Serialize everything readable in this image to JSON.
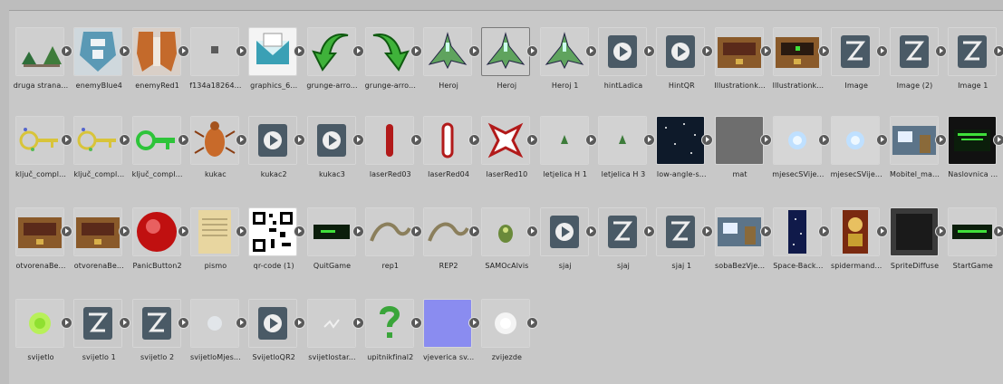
{
  "assets": [
    {
      "label": "druga strana...",
      "icon": "ship-pair"
    },
    {
      "label": "enemyBlue4",
      "icon": "enemy-blue"
    },
    {
      "label": "enemyRed1",
      "icon": "enemy-red"
    },
    {
      "label": "f134a18264...",
      "icon": "tiny-square"
    },
    {
      "label": "graphics_6...",
      "icon": "mail"
    },
    {
      "label": "grunge-arro...",
      "icon": "arrow-left"
    },
    {
      "label": "grunge-arro...",
      "icon": "arrow-right"
    },
    {
      "label": "Heroj",
      "icon": "ship"
    },
    {
      "label": "Heroj",
      "icon": "ship",
      "selected": true
    },
    {
      "label": "Heroj 1",
      "icon": "ship"
    },
    {
      "label": "hintLadica",
      "icon": "play"
    },
    {
      "label": "HintQR",
      "icon": "play"
    },
    {
      "label": "Illustrationk...",
      "icon": "chest"
    },
    {
      "label": "Illustrationk...",
      "icon": "chest-green"
    },
    {
      "label": "Image",
      "icon": "image-gen"
    },
    {
      "label": "Image (2)",
      "icon": "image-gen"
    },
    {
      "label": "Image 1",
      "icon": "image-gen"
    },
    {
      "label": "ključ_compl...",
      "icon": "key"
    },
    {
      "label": "ključ_compl...",
      "icon": "key"
    },
    {
      "label": "ključ_compl...",
      "icon": "key-green"
    },
    {
      "label": "kukac",
      "icon": "bug"
    },
    {
      "label": "kukac2",
      "icon": "play"
    },
    {
      "label": "kukac3",
      "icon": "play"
    },
    {
      "label": "laserRed03",
      "icon": "laser"
    },
    {
      "label": "laserRed04",
      "icon": "laser-outline"
    },
    {
      "label": "laserRed10",
      "icon": "laser-x"
    },
    {
      "label": "letjelica H 1",
      "icon": "tiny-ship"
    },
    {
      "label": "letjelica H 3",
      "icon": "tiny-ship"
    },
    {
      "label": "low-angle-s...",
      "icon": "night"
    },
    {
      "label": "mat",
      "icon": "gray"
    },
    {
      "label": "mjesecSVije...",
      "icon": "glow-blue"
    },
    {
      "label": "mjesecSVije...",
      "icon": "glow-blue"
    },
    {
      "label": "Mobitel_ma...",
      "icon": "room"
    },
    {
      "label": "Naslovnica ...",
      "icon": "title-screen"
    },
    {
      "label": "otvorenaBe...",
      "icon": "chest"
    },
    {
      "label": "otvorenaBe...",
      "icon": "chest"
    },
    {
      "label": "PanicButton2",
      "icon": "red-button"
    },
    {
      "label": "pismo",
      "icon": "letter"
    },
    {
      "label": "qr-code (1)",
      "icon": "qr"
    },
    {
      "label": "QuitGame",
      "icon": "quit"
    },
    {
      "label": "rep1",
      "icon": "tail"
    },
    {
      "label": "REP2",
      "icon": "tail"
    },
    {
      "label": "SAMOcAlvis",
      "icon": "blob"
    },
    {
      "label": "sjaj",
      "icon": "play"
    },
    {
      "label": "sjaj",
      "icon": "image-gen"
    },
    {
      "label": "sjaj 1",
      "icon": "image-gen"
    },
    {
      "label": "sobaBezVje...",
      "icon": "room"
    },
    {
      "label": "Space-Back...",
      "icon": "space"
    },
    {
      "label": "spidermand...",
      "icon": "spider"
    },
    {
      "label": "SpriteDiffuse",
      "icon": "dark-square"
    },
    {
      "label": "StartGame",
      "icon": "start"
    },
    {
      "label": "svijetlo",
      "icon": "glow-green"
    },
    {
      "label": "svijetlo 1",
      "icon": "image-gen"
    },
    {
      "label": "svijetlo 2",
      "icon": "image-gen"
    },
    {
      "label": "svijetloMjes...",
      "icon": "glow-faint"
    },
    {
      "label": "SvijetloQR2",
      "icon": "play"
    },
    {
      "label": "svijetlostar...",
      "icon": "sparkle"
    },
    {
      "label": "upitnikfinal2",
      "icon": "question"
    },
    {
      "label": "vjeverica sv...",
      "icon": "purple"
    },
    {
      "label": "zvijezde",
      "icon": "glow-white"
    }
  ]
}
